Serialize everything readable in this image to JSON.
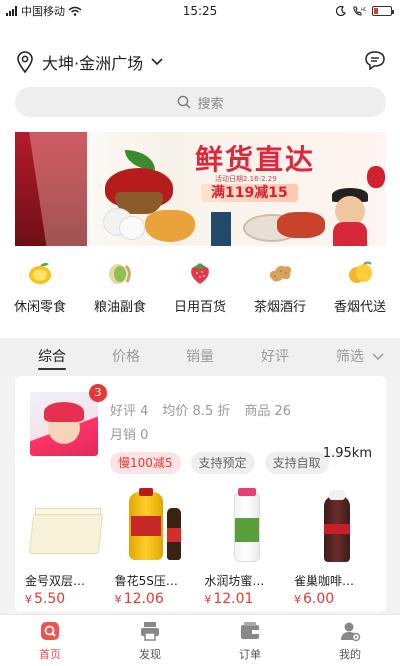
{
  "status_bar": {
    "carrier": "中国移动",
    "time": "15:25"
  },
  "header": {
    "location": "大坤·金洲广场",
    "search_placeholder": "搜索"
  },
  "banner": {
    "title": "鲜货直达",
    "date_text": "活动日期2.16-2.29",
    "promo": "满119减15"
  },
  "categories": [
    {
      "label": "休闲零食",
      "icon": "lemon-icon"
    },
    {
      "label": "粮油副食",
      "icon": "pistachio-icon"
    },
    {
      "label": "日用百货",
      "icon": "strawberry-icon"
    },
    {
      "label": "茶烟酒行",
      "icon": "peanut-icon"
    },
    {
      "label": "香烟代送",
      "icon": "mango-icon"
    }
  ],
  "sort_tabs": [
    "综合",
    "价格",
    "销量",
    "好评",
    "筛选"
  ],
  "shop": {
    "badge": "3",
    "rating": "好评 4",
    "avg": "均价 8.5 折",
    "goods": "商品 26",
    "monthly": "月销 0",
    "tags": [
      "慢100减5",
      "支持预定",
      "支持自取"
    ],
    "distance": "1.95km",
    "products": [
      {
        "name": "金号双层…",
        "price": "5.50"
      },
      {
        "name": "鲁花5S压…",
        "price": "12.06"
      },
      {
        "name": "水润坊蜜…",
        "price": "12.01"
      },
      {
        "name": "雀巢咖啡…",
        "price": "6.00"
      }
    ],
    "currency": "¥"
  },
  "tabbar": [
    {
      "label": "首页",
      "icon": "home-search-icon",
      "active": true
    },
    {
      "label": "发现",
      "icon": "printer-icon",
      "active": false
    },
    {
      "label": "订单",
      "icon": "wallet-icon",
      "active": false
    },
    {
      "label": "我的",
      "icon": "user-gear-icon",
      "active": false
    }
  ],
  "colors": {
    "accent": "#ef5350",
    "price": "#e53935"
  }
}
